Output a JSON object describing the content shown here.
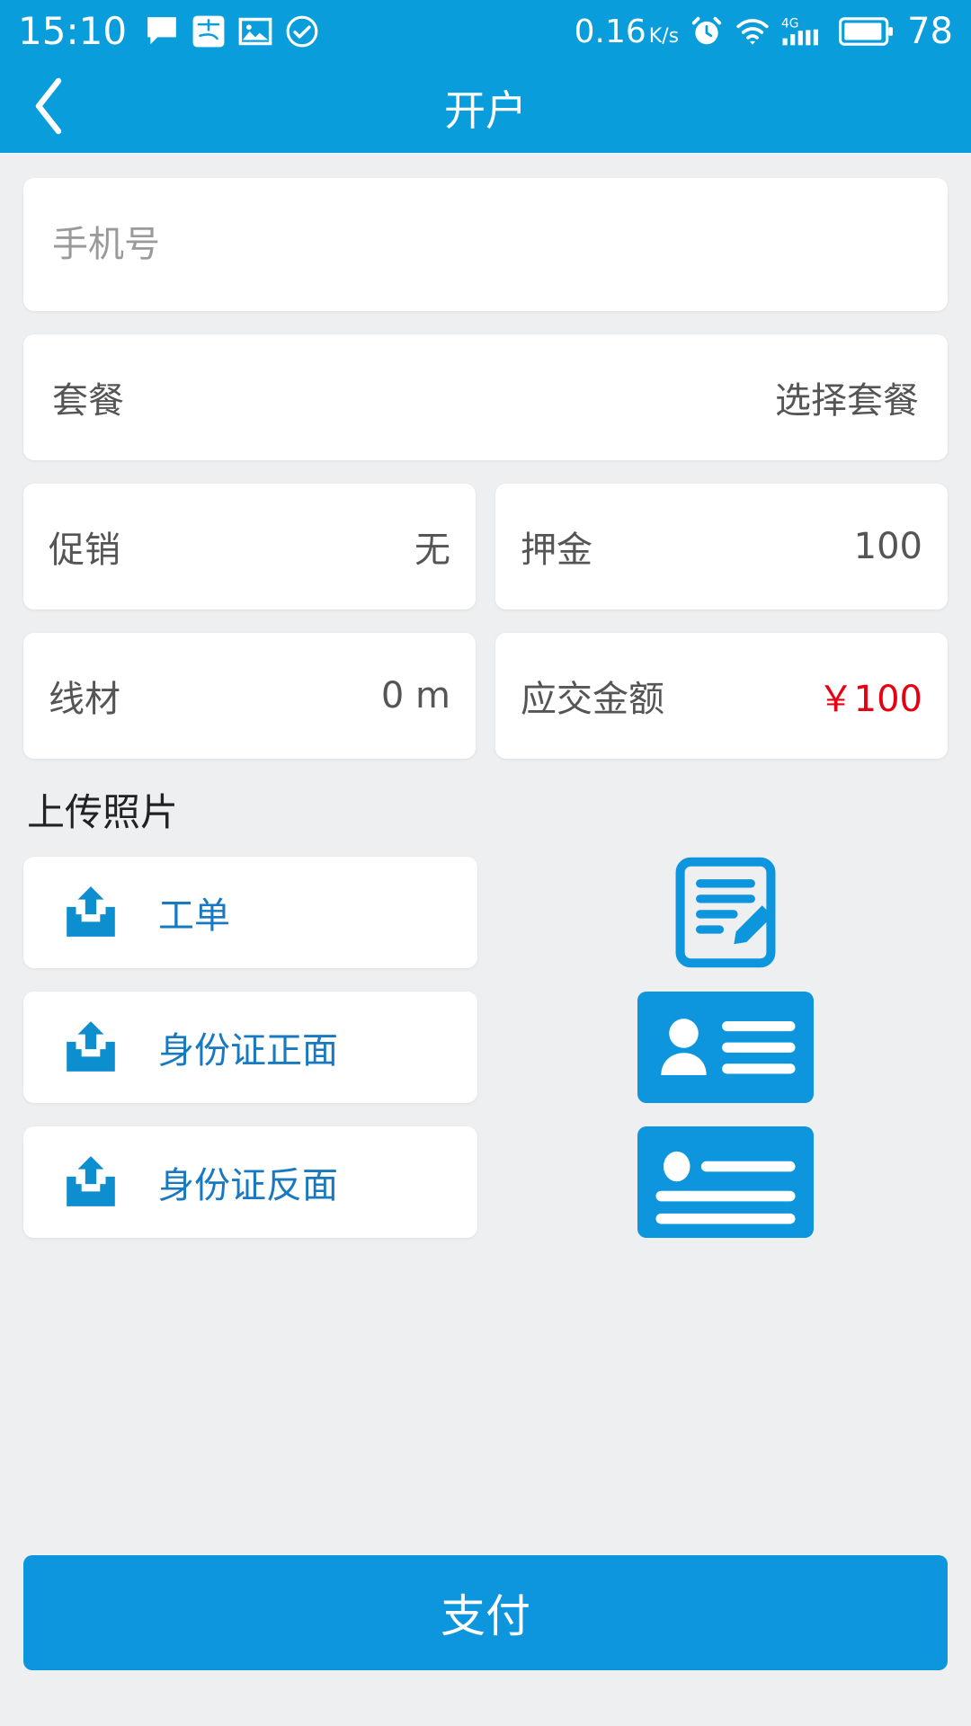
{
  "statusbar": {
    "time": "15:10",
    "left_icons": [
      "message-icon",
      "alipay-icon",
      "gallery-icon",
      "check-circle-icon",
      "sync-icon"
    ],
    "network_speed": "0.16",
    "network_speed_unit_top": "K",
    "network_speed_unit_bottom": "s",
    "right_icons": [
      "alarm-icon",
      "wifi-icon",
      "signal-4g-icon",
      "battery-icon"
    ],
    "signal_label": "4G",
    "battery_percent": "78"
  },
  "titlebar": {
    "back_icon": "chevron-left-icon",
    "title": "开户"
  },
  "form": {
    "phone": {
      "value": "",
      "placeholder": "手机号"
    },
    "plan": {
      "label": "套餐",
      "value": "选择套餐"
    },
    "rows": [
      {
        "label": "促销",
        "value": "无",
        "highlight": false
      },
      {
        "label": "押金",
        "value": "100",
        "highlight": false
      },
      {
        "label": "线材",
        "value": "0 m",
        "highlight": false
      },
      {
        "label": "应交金额",
        "value": "￥100",
        "highlight": true
      }
    ]
  },
  "upload": {
    "section_title": "上传照片",
    "items": [
      {
        "label": "工单",
        "icon": "upload-tray-icon",
        "preview": "document-edit-icon"
      },
      {
        "label": "身份证正面",
        "icon": "upload-tray-icon",
        "preview": "id-card-front-icon"
      },
      {
        "label": "身份证反面",
        "icon": "upload-tray-icon",
        "preview": "id-card-back-icon"
      }
    ]
  },
  "footer": {
    "pay_label": "支付"
  },
  "colors": {
    "brand_blue": "#0d96dd",
    "status_blue": "#0a9ddb",
    "link_blue": "#1879c0",
    "amount_red": "#e60012",
    "page_bg": "#edeff1"
  }
}
